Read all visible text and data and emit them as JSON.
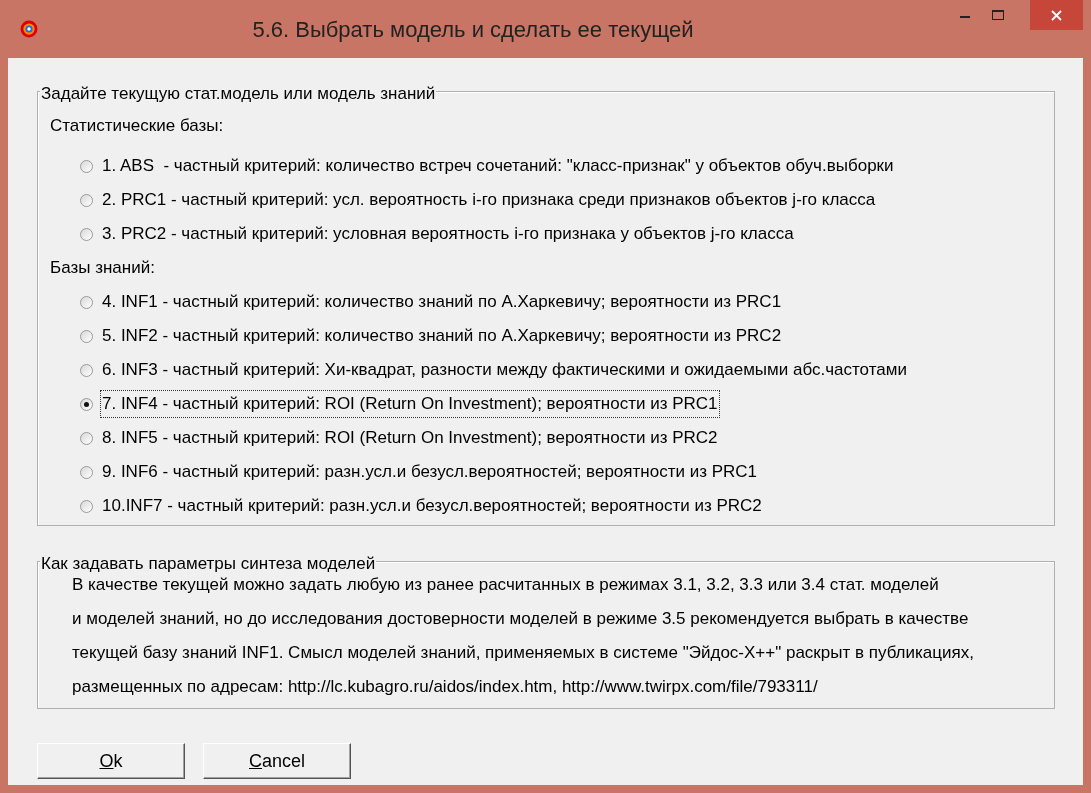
{
  "window": {
    "title": "5.6. Выбрать модель и сделать ее текущей"
  },
  "model_group": {
    "legend": "Задайте текущую стат.модель или модель знаний",
    "sections": [
      {
        "label": "Статистические базы:",
        "options": [
          {
            "label": "1. ABS  - частный критерий: количество встреч сочетаний: \"класс-признак\" у объектов обуч.выборки",
            "selected": false,
            "focused": false
          },
          {
            "label": "2. PRC1 - частный критерий: усл. вероятность i-го признака среди признаков объектов j-го класса",
            "selected": false,
            "focused": false
          },
          {
            "label": "3. PRC2 - частный критерий: условная вероятность i-го признака у объектов j-го класса",
            "selected": false,
            "focused": false
          }
        ]
      },
      {
        "label": "Базы знаний:",
        "options": [
          {
            "label": "4. INF1 - частный критерий: количество знаний по А.Харкевичу; вероятности из PRC1",
            "selected": false,
            "focused": false
          },
          {
            "label": "5. INF2 - частный критерий: количество знаний по А.Харкевичу; вероятности из PRC2",
            "selected": false,
            "focused": false
          },
          {
            "label": "6. INF3 - частный критерий: Хи-квадрат, разности между фактическими и ожидаемыми абс.частотами",
            "selected": false,
            "focused": false
          },
          {
            "label": "7. INF4 - частный критерий: ROI (Return On Investment); вероятности из PRC1",
            "selected": true,
            "focused": true
          },
          {
            "label": "8. INF5 - частный критерий: ROI (Return On Investment); вероятности из PRC2",
            "selected": false,
            "focused": false
          },
          {
            "label": "9. INF6 - частный критерий: разн.усл.и безусл.вероятностей; вероятности из PRC1",
            "selected": false,
            "focused": false
          },
          {
            "label": "10.INF7 - частный критерий: разн.усл.и безусл.вероятностей; вероятности из PRC2",
            "selected": false,
            "focused": false
          }
        ]
      }
    ]
  },
  "help_group": {
    "legend": "Как задавать параметры синтеза моделей",
    "lines": [
      "В качестве текущей можно задать любую из ранее расчитанных в режимах 3.1, 3.2, 3.3 или 3.4 стат. моделей",
      "и моделей знаний, но до исследования достоверности моделей в режиме 3.5 рекомендуется выбрать в качестве",
      "текущей базу знаний INF1. Смысл моделей знаний, применяемых в системе \"Эйдос-Х++\" раскрыт в публикациях,",
      "размещенных по адресам: http://lc.kubagro.ru/aidos/index.htm, http://www.twirpx.com/file/793311/"
    ]
  },
  "buttons": [
    "Ok",
    "Cancel"
  ]
}
